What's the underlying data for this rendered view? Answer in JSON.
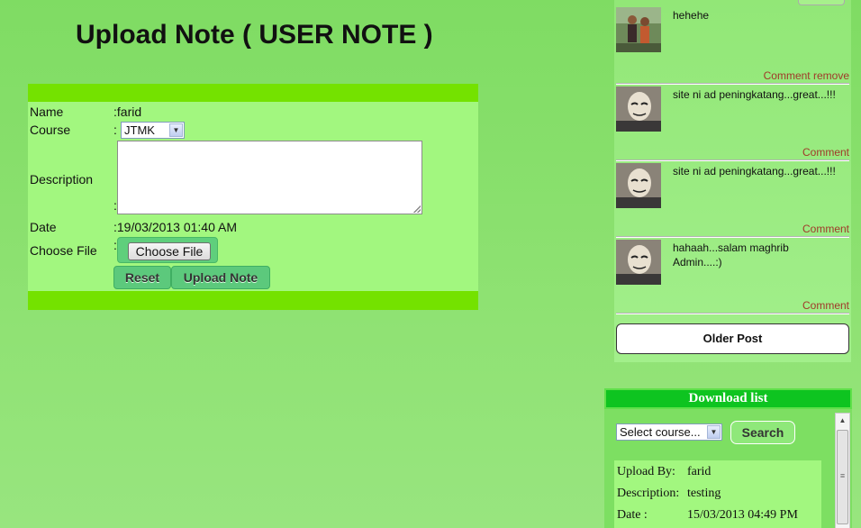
{
  "page_title": "Upload Note ( USER NOTE )",
  "form": {
    "name_label": "Name",
    "name_value": ":farid",
    "course_label": "Course",
    "course_colon": ":",
    "course_selected": "JTMK",
    "description_label": "Description",
    "description_colon": ":",
    "description_value": "",
    "date_label": "Date",
    "date_value": ":19/03/2013 01:40 AM",
    "file_label": "Choose File",
    "file_colon": ":",
    "file_button": "Choose File",
    "reset_button": "Reset",
    "upload_button": "Upload Note"
  },
  "comments": [
    {
      "text": "hehehe",
      "link": "Comment remove",
      "avatar": "group-photo-avatar"
    },
    {
      "text": "site ni ad peningkatang...great...!!!",
      "link": "Comment",
      "avatar": "mask-avatar"
    },
    {
      "text": "site ni ad peningkatang...great...!!!",
      "link": "Comment",
      "avatar": "mask-avatar"
    },
    {
      "text": "hahaah...salam maghrib Admin....:)",
      "link": "Comment",
      "avatar": "mask-avatar"
    }
  ],
  "older_post_button": "Older Post",
  "download": {
    "header": "Download list",
    "select_placeholder": "Select course...",
    "search_button": "Search",
    "entry": {
      "upload_by_label": "Upload By:",
      "upload_by_value": "farid",
      "description_label": "Description:",
      "description_value": "testing",
      "date_label": "Date :",
      "date_value": "15/03/2013 04:49 PM"
    }
  },
  "colors": {
    "bar_green": "#74e200",
    "form_bg": "#a2f77f",
    "header_green": "#0ec420",
    "link_red": "#a03a2a"
  }
}
